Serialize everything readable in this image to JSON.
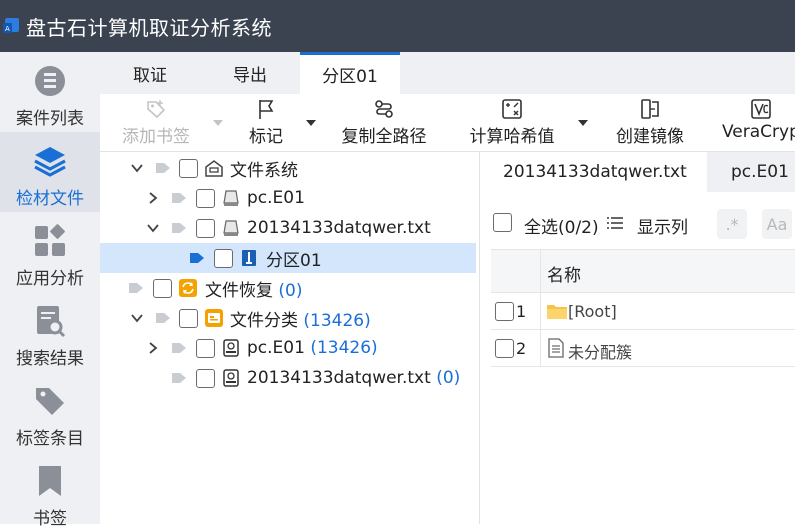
{
  "app": {
    "title": "盘古石计算机取证分析系统",
    "icon": "app-logo-icon"
  },
  "sidebar": {
    "items": [
      {
        "label": "案件列表",
        "icon": "case-list-icon",
        "active": false
      },
      {
        "label": "检材文件",
        "icon": "layers-icon",
        "active": true
      },
      {
        "label": "应用分析",
        "icon": "apps-icon",
        "active": false
      },
      {
        "label": "搜索结果",
        "icon": "search-result-icon",
        "active": false
      },
      {
        "label": "标签条目",
        "icon": "tag-icon",
        "active": false
      },
      {
        "label": "书签",
        "icon": "bookmark-icon",
        "active": false
      }
    ]
  },
  "tabs": [
    {
      "label": "取证",
      "active": false
    },
    {
      "label": "导出",
      "active": false
    },
    {
      "label": "分区01",
      "active": true
    }
  ],
  "toolbar": {
    "add_bookmark": "添加书签",
    "mark": "标记",
    "copy_full_path": "复制全路径",
    "compute_hash": "计算哈希值",
    "create_image": "创建镜像",
    "veracrypt": "VeraCrypt"
  },
  "tree": {
    "filesystem": "文件系统",
    "pc_e01": "pc.E01",
    "txt_file": "20134133datqwer.txt",
    "partition": "分区01",
    "file_recovery": "文件恢复",
    "file_recovery_count": "(0)",
    "file_category": "文件分类",
    "file_category_count": "(13426)",
    "cat_pc_e01": "pc.E01",
    "cat_pc_e01_count": "(13426)",
    "cat_txt": "20134133datqwer.txt",
    "cat_txt_count": "(0)"
  },
  "right": {
    "file_tabs": [
      "20134133datqwer.txt",
      "pc.E01"
    ],
    "select_all": "全选(0/2)",
    "show_columns": "显示列",
    "regex_btn": ".*",
    "case_btn": "Aa",
    "column_name": "名称",
    "rows": [
      {
        "num": "1",
        "name": "[Root]",
        "icon": "folder-icon"
      },
      {
        "num": "2",
        "name": "未分配簇",
        "icon": "document-icon"
      }
    ]
  },
  "colors": {
    "titlebar": "#3b4250",
    "accent": "#1a6fd6",
    "selection": "#d4e6fb"
  }
}
